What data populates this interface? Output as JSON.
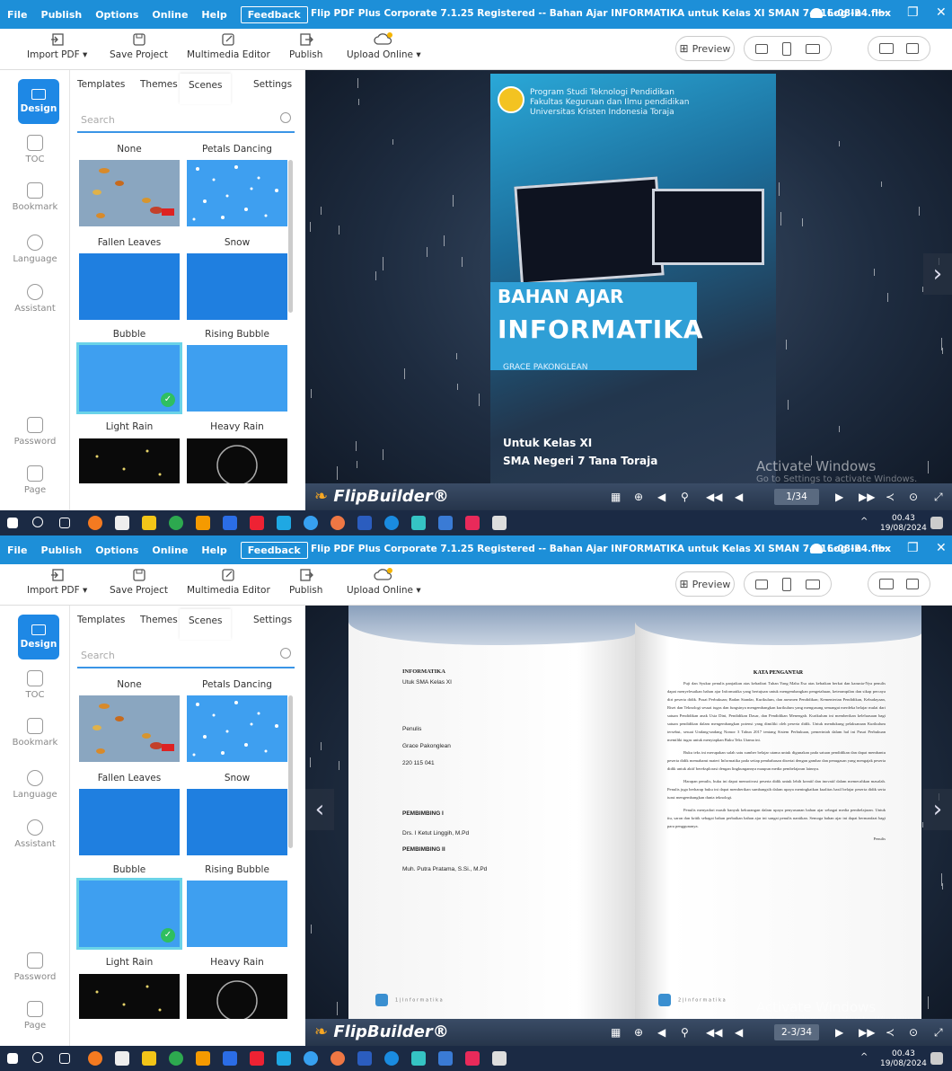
{
  "menu": [
    "File",
    "Publish",
    "Options",
    "Online",
    "Help"
  ],
  "feedback": "Feedback",
  "title": "Flip PDF Plus Corporate 7.1.25 Registered -- Bahan Ajar INFORMATIKA untuk Kelas XI SMAN 7-- 16-08-24.flbx",
  "login": "Log In",
  "tools": {
    "import": "Import PDF",
    "save": "Save Project",
    "mme": "Multimedia Editor",
    "publish": "Publish",
    "upload": "Upload Online"
  },
  "preview": "Preview",
  "nav": {
    "design": "Design",
    "toc": "TOC",
    "bookmark": "Bookmark",
    "language": "Language",
    "assistant": "Assistant",
    "password": "Password",
    "page": "Page"
  },
  "tabs": [
    "Templates",
    "Themes",
    "Scenes",
    "Settings"
  ],
  "search_placeholder": "Search",
  "scenes": [
    "None",
    "Petals Dancing",
    "Fallen Leaves",
    "Snow",
    "Bubble",
    "Rising Bubble",
    "Light Rain",
    "Heavy Rain"
  ],
  "brand": "FlipBuilder",
  "activate": {
    "title": "Activate Windows",
    "sub": "Go to Settings to activate Windows."
  },
  "shot1": {
    "page_indicator": "1/34",
    "cover": {
      "institution": [
        "Program Studi Teknologi Pendidikan",
        "Fakultas Keguruan dan Ilmu pendidikan",
        "Universitas Kristen Indonesia Toraja"
      ],
      "title1": "BAHAN AJAR",
      "title2": "INFORMATIKA",
      "author": "GRACE PAKONGLEAN",
      "kelas": "Untuk Kelas XI",
      "school": "SMA Negeri 7 Tana Toraja"
    }
  },
  "shot2": {
    "page_indicator": "2-3/34",
    "left_page": {
      "title": "INFORMATIKA",
      "subtitle": "Utuk SMA Kelas XI",
      "penulis_label": "Penulis",
      "penulis": "Grace Pakonglean",
      "nim": "220 115 041",
      "pemb1_label": "PEMBIMBING I",
      "pemb1": "Drs. I Ketut Linggih, M.Pd",
      "pemb2_label": "PEMBIMBING II",
      "pemb2": "Muh. Putra Pratama, S.Si., M.Pd",
      "footer": "1 | I n f o r m a t i k a"
    },
    "right_page": {
      "title": "KATA PENGANTAR",
      "paragraphs": [
        "Puji dan Syukur penulis panjatkan atas kehadirat Tuhan Yang Maha Esa atas kebaikan berkat dan karunia-Nya penulis dapat menyelesaikan bahan ajar Informatika yang bertujuan untuk mengembangkan pengetahuan, keterampilan dan sikap percaya diri peserta didik. Pusat Perbukuan; Badan Standar, Kurikulum, dan asesmen Pendidikan; Kementerian Pendidikan, Kebudayaan, Riset dan Teknologi sesuai tugas dan fungsinya mengembangkan kurikulum yang mengusung semangat merdeka belajar mulai dari satuan Pendidikan anak Usia Dini, Pendidikan Dasar, dan Pendidikan Menengah. Kurikulum ini memberikan keleluasaan bagi satuan pendidikan dalam mengembangkan potensi yang dimiliki oleh peserta didik. Untuk mendukung pelaksanaan Kurikulum tersebut, sesuai Undang-undang Nomor 3 Tahun 2017 tentang Sistem Perbukuan, pemerintah dalam hal ini Pusat Perbukuan memiliki tugas untuk menyiapkan Buku Teks Utama ini.",
        "Buku teks ini merupakan salah satu sumber belajar utama untuk digunakan pada satuan pendidikan dan dapat membantu peserta didik memahami materi Informatika pada setiap pembahasan disertai dengan gambar dan penugasan yang mengajak peserta didik untuk aktif bereksplorasi dengan lingkungannya maupun media pembelajaran lainnya.",
        "Harapan penulis, buku ini dapat memotivasi peserta didik untuk lebih kreatif dan inovatif dalam memecahkan masalah. Penulis juga berharap buku ini dapat memberikan sumbangsih dalam upaya meningkatkan kualitas hasil belajar peserta didik serta turut mengembangkan dunia teknologi.",
        "Penulis menyadari masih banyak kekurangan dalam upaya penyusunan bahan ajar sebagai media pembelajaran. Untuk itu, saran dan kritik sebagai bahan perbaikan bahan ajar ini sangat penulis nantikan. Semoga bahan ajar ini dapat bermanfaat bagi para penggunanya."
      ],
      "sign": "Penulis",
      "footer": "2 | I n f o r m a t i k a"
    }
  },
  "clock": {
    "time": "00.43",
    "date": "19/08/2024"
  },
  "colors": {
    "accent": "#1d8fd8",
    "nav_active": "#1e88e5",
    "stage": "#1e2c40"
  }
}
